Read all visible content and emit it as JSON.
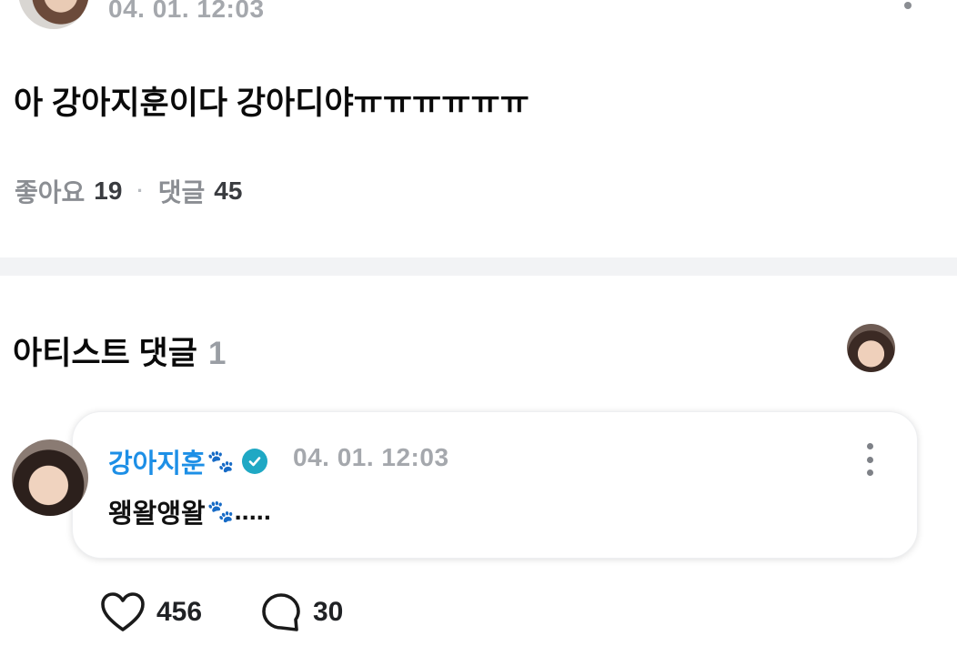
{
  "post": {
    "date": "04. 01. 12:03",
    "body": "아 강아지훈이다 강아디야ㅠㅠㅠㅠㅠㅠ",
    "likes_label": "좋아요",
    "likes_count": "19",
    "separator": "·",
    "comments_label": "댓글",
    "comments_count": "45"
  },
  "artist_comments": {
    "title": "아티스트 댓글",
    "count": "1"
  },
  "comment": {
    "author": "강아지훈",
    "date": "04. 01. 12:03",
    "text": "왱왈앵왈",
    "text_suffix": ".....",
    "paw_emoji": "🐾",
    "likes": "456",
    "replies": "30"
  },
  "colors": {
    "author_blue": "#1d8fe6",
    "verified_teal": "#1fa8c4",
    "meta_gray": "#a5a8ad"
  }
}
